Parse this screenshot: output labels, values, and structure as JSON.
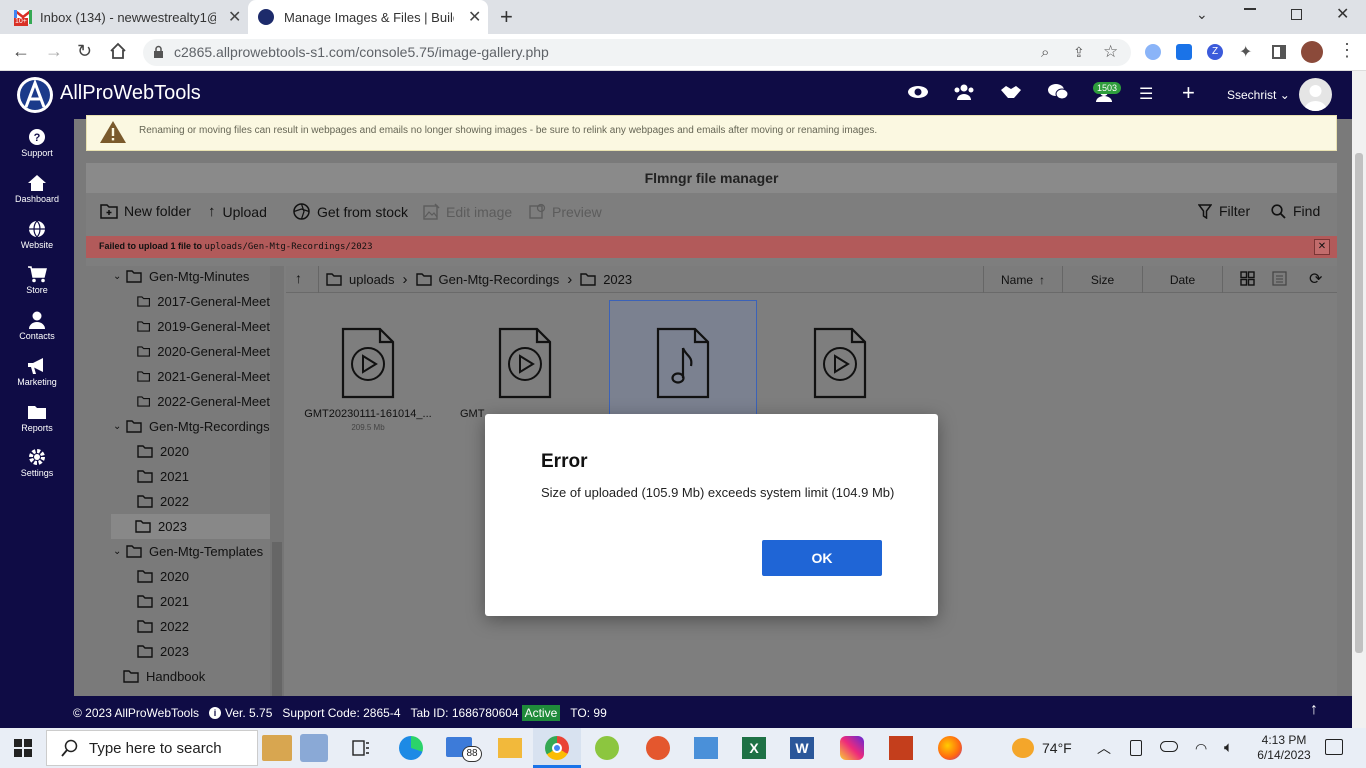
{
  "browser": {
    "tabs": [
      {
        "title": "Inbox (134) - newwestrealty1@gr",
        "favicon_badge": "10+"
      },
      {
        "title": "Manage Images & Files | Builder"
      }
    ],
    "url": "c2865.allprowebtools-s1.com/console5.75/image-gallery.php"
  },
  "header": {
    "brand": "AllProWebTools",
    "badge_count": "1503",
    "user": "Ssechrist"
  },
  "sidebar": {
    "items": [
      {
        "label": "Support",
        "icon": "question-icon"
      },
      {
        "label": "Dashboard",
        "icon": "home-icon"
      },
      {
        "label": "Website",
        "icon": "globe-icon"
      },
      {
        "label": "Store",
        "icon": "cart-icon"
      },
      {
        "label": "Contacts",
        "icon": "person-icon"
      },
      {
        "label": "Marketing",
        "icon": "megaphone-icon"
      },
      {
        "label": "Reports",
        "icon": "folder-icon"
      },
      {
        "label": "Settings",
        "icon": "gear-icon"
      }
    ]
  },
  "warning": {
    "text": "Renaming or moving files can result in webpages and emails no longer showing images - be sure to relink any webpages and emails after moving or renaming images."
  },
  "file_manager": {
    "title": "Flmngr file manager",
    "toolbar": {
      "new_folder": "New folder",
      "upload": "Upload",
      "get_from_stock": "Get from stock",
      "edit_image": "Edit image",
      "preview": "Preview",
      "filter": "Filter",
      "find": "Find"
    },
    "error_banner": {
      "prefix": "Failed to upload 1 file to",
      "path": "uploads/Gen-Mtg-Recordings/2023"
    },
    "tree": [
      {
        "label": "Gen-Mtg-Minutes",
        "level": 1,
        "expanded": true
      },
      {
        "label": "2017-General-Meet",
        "level": 2
      },
      {
        "label": "2019-General-Meet",
        "level": 2
      },
      {
        "label": "2020-General-Meet",
        "level": 2
      },
      {
        "label": "2021-General-Meet",
        "level": 2
      },
      {
        "label": "2022-General-Meet",
        "level": 2
      },
      {
        "label": "Gen-Mtg-Recordings",
        "level": 1,
        "expanded": true
      },
      {
        "label": "2020",
        "level": 2
      },
      {
        "label": "2021",
        "level": 2
      },
      {
        "label": "2022",
        "level": 2
      },
      {
        "label": "2023",
        "level": 2,
        "selected": true
      },
      {
        "label": "Gen-Mtg-Templates",
        "level": 1,
        "expanded": true
      },
      {
        "label": "2020",
        "level": 2
      },
      {
        "label": "2021",
        "level": 2
      },
      {
        "label": "2022",
        "level": 2
      },
      {
        "label": "2023",
        "level": 2
      },
      {
        "label": "Handbook",
        "level": 1
      }
    ],
    "breadcrumb": [
      "uploads",
      "Gen-Mtg-Recordings",
      "2023"
    ],
    "columns": {
      "name": "Name",
      "size": "Size",
      "date": "Date"
    },
    "files": [
      {
        "name": "GMT20230111-161014_...",
        "size": "209.5 Mb",
        "type": "video"
      },
      {
        "name": "GMT",
        "size": "",
        "type": "video"
      },
      {
        "name": "",
        "size": "",
        "type": "audio",
        "selected": true
      },
      {
        "name": "",
        "size": "",
        "type": "video"
      }
    ]
  },
  "modal": {
    "title": "Error",
    "message": "Size of uploaded (105.9 Mb) exceeds system limit (104.9 Mb)",
    "ok": "OK"
  },
  "footer": {
    "copyright": "© 2023 AllProWebTools",
    "version": "Ver. 5.75",
    "support_code": "Support Code: 2865-4",
    "tab_id": "Tab ID: 1686780604",
    "status": "Active",
    "to": "TO: 99"
  },
  "taskbar": {
    "search_placeholder": "Type here to search",
    "mail_count": "88",
    "weather": "74°F",
    "time": "4:13 PM",
    "date": "6/14/2023"
  }
}
